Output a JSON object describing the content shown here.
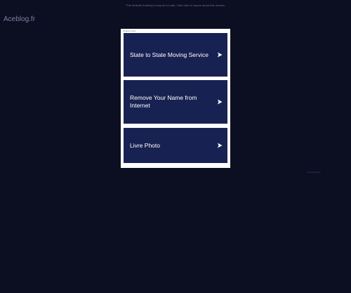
{
  "header": {
    "notice": "This Website Aceblog.fr may be for sale. Click here to inquire about this domain.",
    "logo": "Aceblog.fr"
  },
  "panel": {
    "label": "Related Links",
    "links": [
      {
        "label": "State to State Moving Service",
        "icon": "chevron-right-icon"
      },
      {
        "label": "Remove Your Name from Internet",
        "icon": "chevron-right-icon"
      },
      {
        "label": "Livre Photo",
        "icon": "chevron-right-icon"
      }
    ]
  },
  "footer": {
    "privacy": "Privacy Policy"
  },
  "colors": {
    "background": "#0c0e22",
    "link_bg": "#182252",
    "panel_bg": "#ffffff",
    "text": "#ffffff"
  }
}
